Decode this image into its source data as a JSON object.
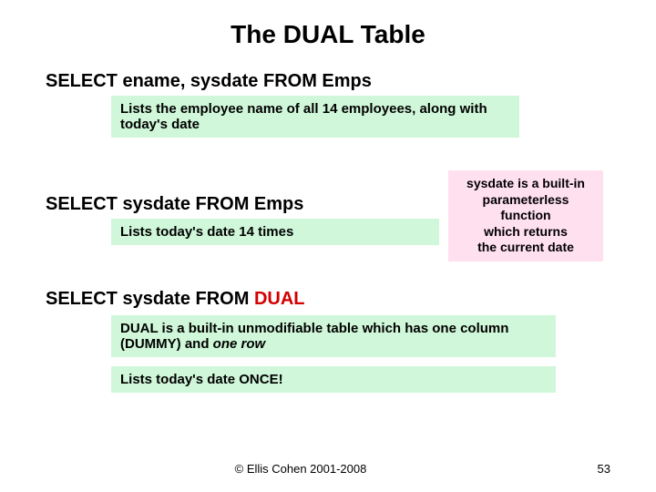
{
  "title": "The DUAL Table",
  "q1": {
    "sql": "SELECT ename, sysdate FROM Emps",
    "desc": "Lists the employee name of all 14 employees, along with today's date"
  },
  "q2": {
    "sql": "SELECT sysdate FROM Emps",
    "desc": "Lists today's date 14 times",
    "note_l1": "sysdate is a built-in",
    "note_l2": "parameterless",
    "note_l3": "function",
    "note_l4": "which returns",
    "note_l5": "the current date"
  },
  "q3": {
    "sql_prefix": "SELECT sysdate FROM ",
    "sql_dual": "DUAL",
    "desc_a": "DUAL is a built-in unmodifiable table which has one column (DUMMY) and ",
    "desc_a_em": "one row",
    "desc_b": "Lists today's date ONCE!"
  },
  "copyright": "© Ellis Cohen 2001-2008",
  "page": "53"
}
